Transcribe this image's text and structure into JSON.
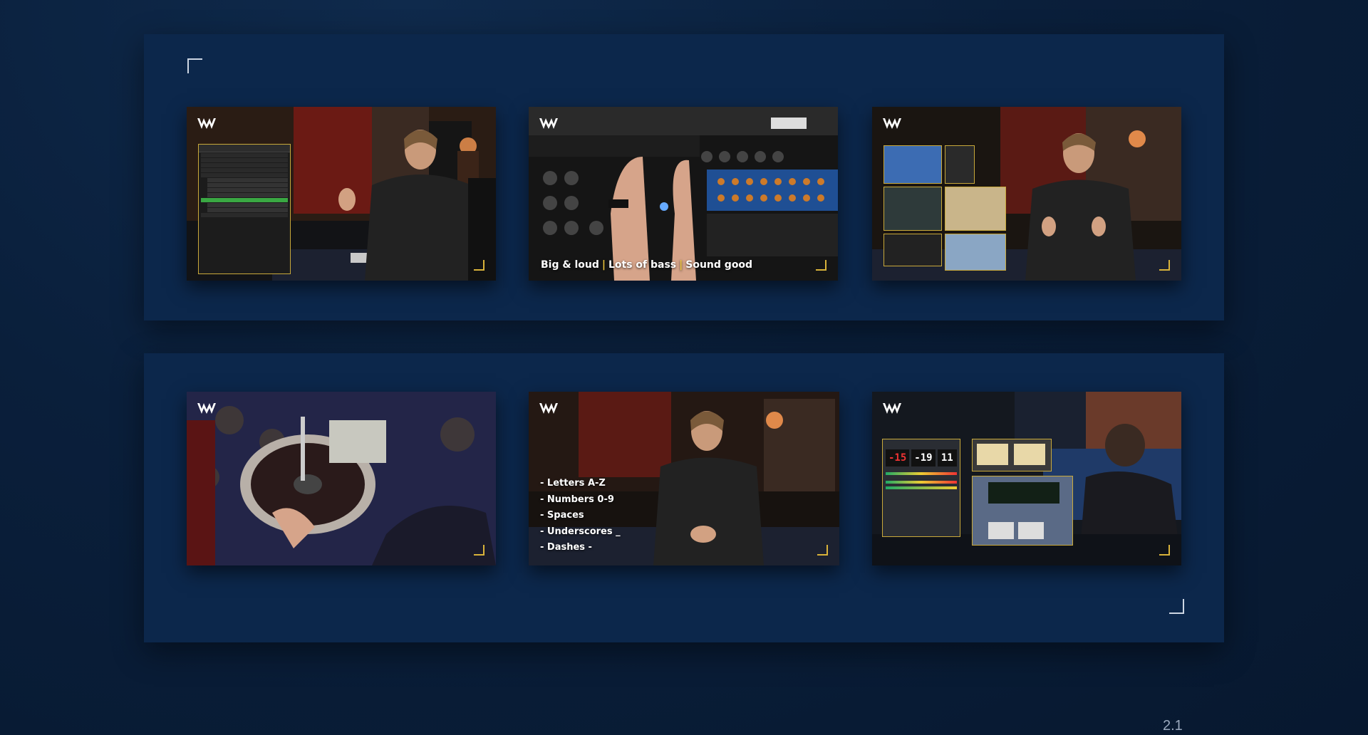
{
  "thumbnails_top": [
    {
      "id": 1,
      "scene": "presenter-file-browser",
      "logo_icon": "waves-logo-icon"
    },
    {
      "id": 2,
      "scene": "hands-on-outboard-gear",
      "logo_icon": "waves-logo-icon",
      "caption": {
        "part1": "Big & loud",
        "sep": "|",
        "part2": "Lots of bass",
        "part3": "Sound good"
      }
    },
    {
      "id": 3,
      "scene": "presenter-plugin-windows",
      "logo_icon": "waves-logo-icon"
    }
  ],
  "thumbnails_bottom": [
    {
      "id": 4,
      "scene": "vinyl-lathe-cutting",
      "logo_icon": "waves-logo-icon"
    },
    {
      "id": 5,
      "scene": "presenter-naming-rules",
      "logo_icon": "waves-logo-icon",
      "bullets": [
        "- Letters A-Z",
        "- Numbers 0-9",
        "- Spaces",
        "- Underscores _",
        "- Dashes -"
      ]
    },
    {
      "id": 6,
      "scene": "loudness-meters",
      "logo_icon": "waves-logo-icon",
      "meter_values": [
        "-15",
        "-19",
        "11"
      ]
    }
  ],
  "page_number": "2.1",
  "colors": {
    "background": "#0a1f3b",
    "panel": "#0c274b",
    "accent_yellow": "#d8b23a",
    "corner_marks": "#cdd6e3"
  }
}
